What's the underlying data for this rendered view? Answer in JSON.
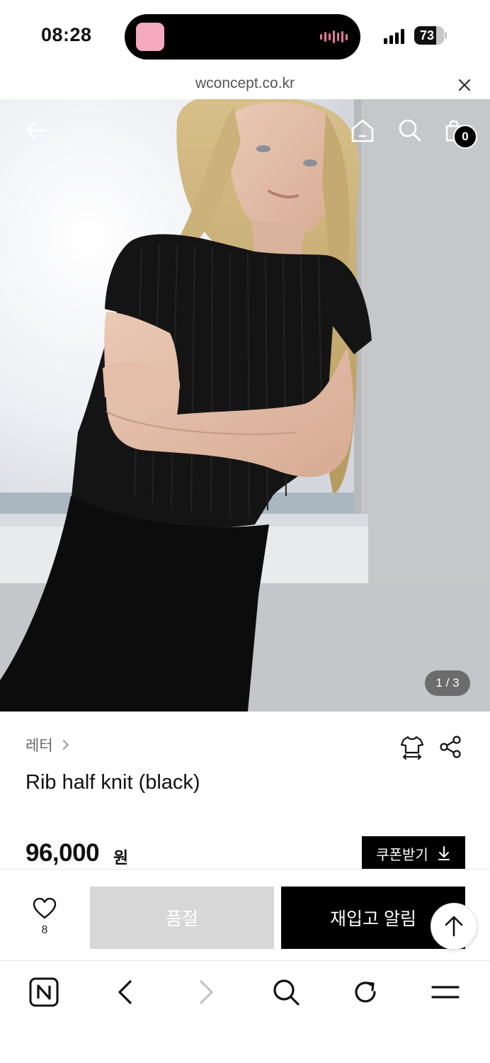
{
  "status_bar": {
    "time": "08:28",
    "battery": "73",
    "battery_level": 0.73
  },
  "browser": {
    "url": "wconcept.co.kr"
  },
  "hero": {
    "page_indicator": "1 / 3",
    "cart_count": "0"
  },
  "product": {
    "brand": "레터",
    "name": "Rib half knit (black)",
    "price": "96,000",
    "price_unit": "원",
    "coupon_label": "쿠폰받기"
  },
  "actions": {
    "wish_count": "8",
    "soldout_label": "품절",
    "restock_label": "재입고 알림"
  },
  "icons": {
    "back": "arrow-left-icon",
    "home": "home-icon",
    "search": "search-icon",
    "cart": "shopping-bag-icon",
    "size_guide": "tshirt-size-icon",
    "share": "share-icon",
    "wish": "heart-icon",
    "scroll_top": "arrow-up-icon"
  }
}
